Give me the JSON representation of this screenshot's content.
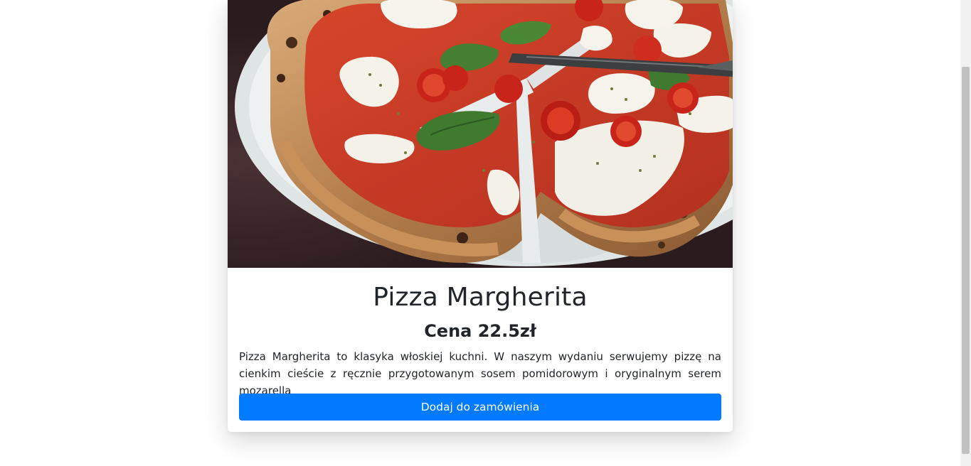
{
  "product": {
    "image_alt": "Pizza Margherita",
    "title": "Pizza Margherita",
    "price": "Cena 22.5zł",
    "description": "Pizza Margherita to klasyka włoskiej kuchni. W naszym wydaniu serwujemy pizzę na cienkim cieście z ręcznie przygotowanym sosem pomidorowym i oryginalnym serem mozarella",
    "add_button_label": "Dodaj do zamówienia"
  },
  "colors": {
    "accent": "#007bff",
    "text": "#212529",
    "background": "#ffffff"
  },
  "icons": {
    "product_image": "pizza-photo"
  }
}
